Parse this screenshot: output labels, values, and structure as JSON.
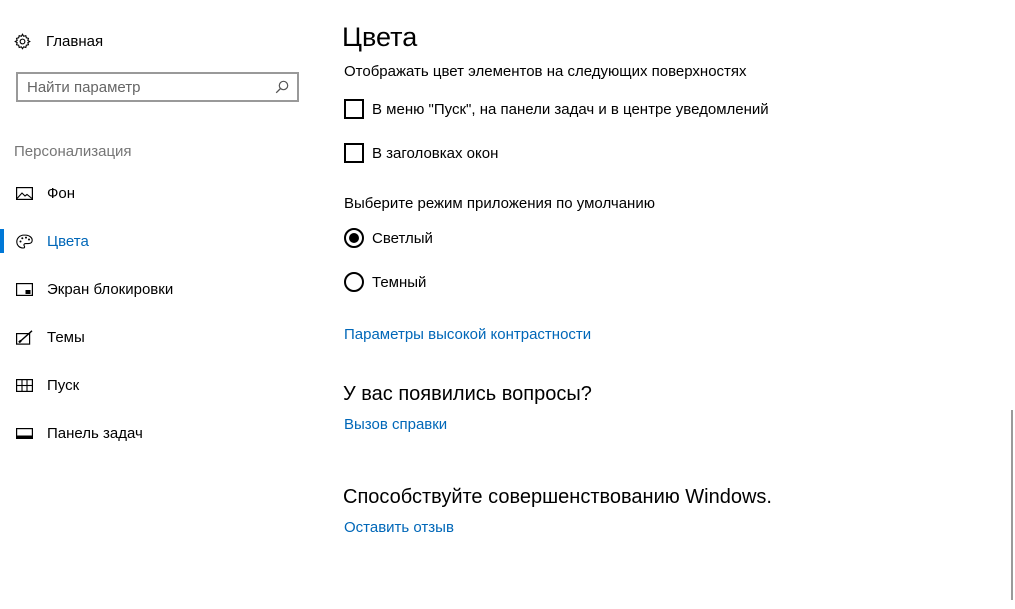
{
  "sidebar": {
    "home_label": "Главная",
    "search_placeholder": "Найти параметр",
    "section_title": "Персонализация",
    "items": [
      {
        "label": "Фон",
        "icon": "picture-icon"
      },
      {
        "label": "Цвета",
        "icon": "palette-icon",
        "selected": true
      },
      {
        "label": "Экран блокировки",
        "icon": "lock-screen-icon"
      },
      {
        "label": "Темы",
        "icon": "themes-icon"
      },
      {
        "label": "Пуск",
        "icon": "start-icon"
      },
      {
        "label": "Панель задач",
        "icon": "taskbar-icon"
      }
    ]
  },
  "main": {
    "title": "Цвета",
    "surfaces_label": "Отображать цвет элементов на следующих поверхностях",
    "checkbox_start": {
      "label": "В меню \"Пуск\", на панели задач и в центре уведомлений",
      "checked": false
    },
    "checkbox_titlebars": {
      "label": "В заголовках окон",
      "checked": false
    },
    "app_mode_label": "Выберите режим приложения по умолчанию",
    "radio_light": {
      "label": "Светлый",
      "checked": true
    },
    "radio_dark": {
      "label": "Темный",
      "checked": false
    },
    "high_contrast_link": "Параметры высокой контрастности",
    "questions_heading": "У вас появились вопросы?",
    "help_link": "Вызов справки",
    "improve_heading": "Способствуйте совершенствованию Windows.",
    "feedback_link": "Оставить отзыв"
  },
  "colors": {
    "accent": "#0078d7",
    "link": "#0067b8",
    "muted_text": "#767676"
  }
}
